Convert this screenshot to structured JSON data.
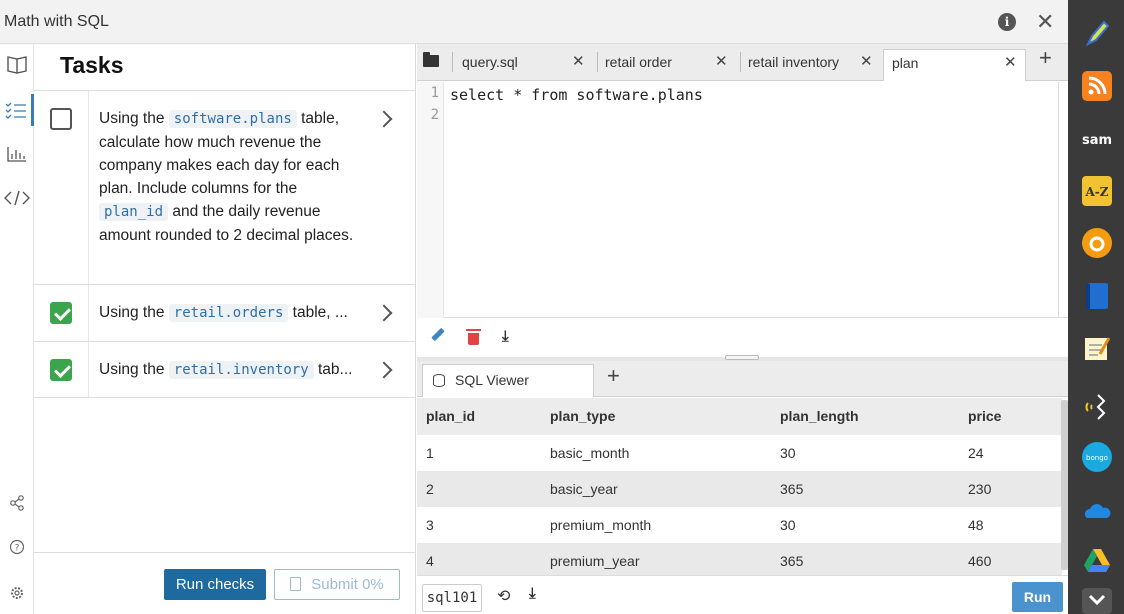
{
  "window": {
    "title": "Math with SQL"
  },
  "tasks": {
    "heading": "Tasks",
    "items": [
      {
        "prefix": "Using the ",
        "code": "software.plans",
        "rest1": " table, calculate how much revenue the company makes each day for each plan. Include columns for the ",
        "code2": "plan_id",
        "rest2": " and the daily revenue amount rounded to 2 decimal places.",
        "done": false
      },
      {
        "prefix": "Using the ",
        "code": "retail.orders",
        "rest1": " table, ...",
        "done": true
      },
      {
        "prefix": "Using the ",
        "code": "retail.inventory",
        "rest1": " tab...",
        "done": true
      }
    ],
    "run_checks_label": "Run checks",
    "submit_label": "Submit 0%"
  },
  "editor": {
    "tabs": [
      {
        "label": "query.sql",
        "close": "✕"
      },
      {
        "label": "retail order",
        "close": "✕"
      },
      {
        "label": "retail inventory",
        "close": "✕"
      },
      {
        "label": "plan",
        "close": "✕"
      }
    ],
    "add_tab": "+",
    "lines": [
      {
        "num": "1",
        "text": "select * from software.plans"
      },
      {
        "num": "2",
        "text": ""
      }
    ]
  },
  "viewer": {
    "tab_label": "SQL Viewer",
    "add_tab": "+",
    "columns": [
      "plan_id",
      "plan_type",
      "plan_length",
      "price"
    ],
    "rows": [
      [
        "1",
        "basic_month",
        "30",
        "24"
      ],
      [
        "2",
        "basic_year",
        "365",
        "230"
      ],
      [
        "3",
        "premium_month",
        "30",
        "48"
      ],
      [
        "4",
        "premium_year",
        "365",
        "460"
      ]
    ],
    "database": "sql101",
    "run_label": "Run"
  },
  "icons": {
    "info": "i",
    "close": "✕",
    "history": "⟲",
    "download": "⤓"
  }
}
